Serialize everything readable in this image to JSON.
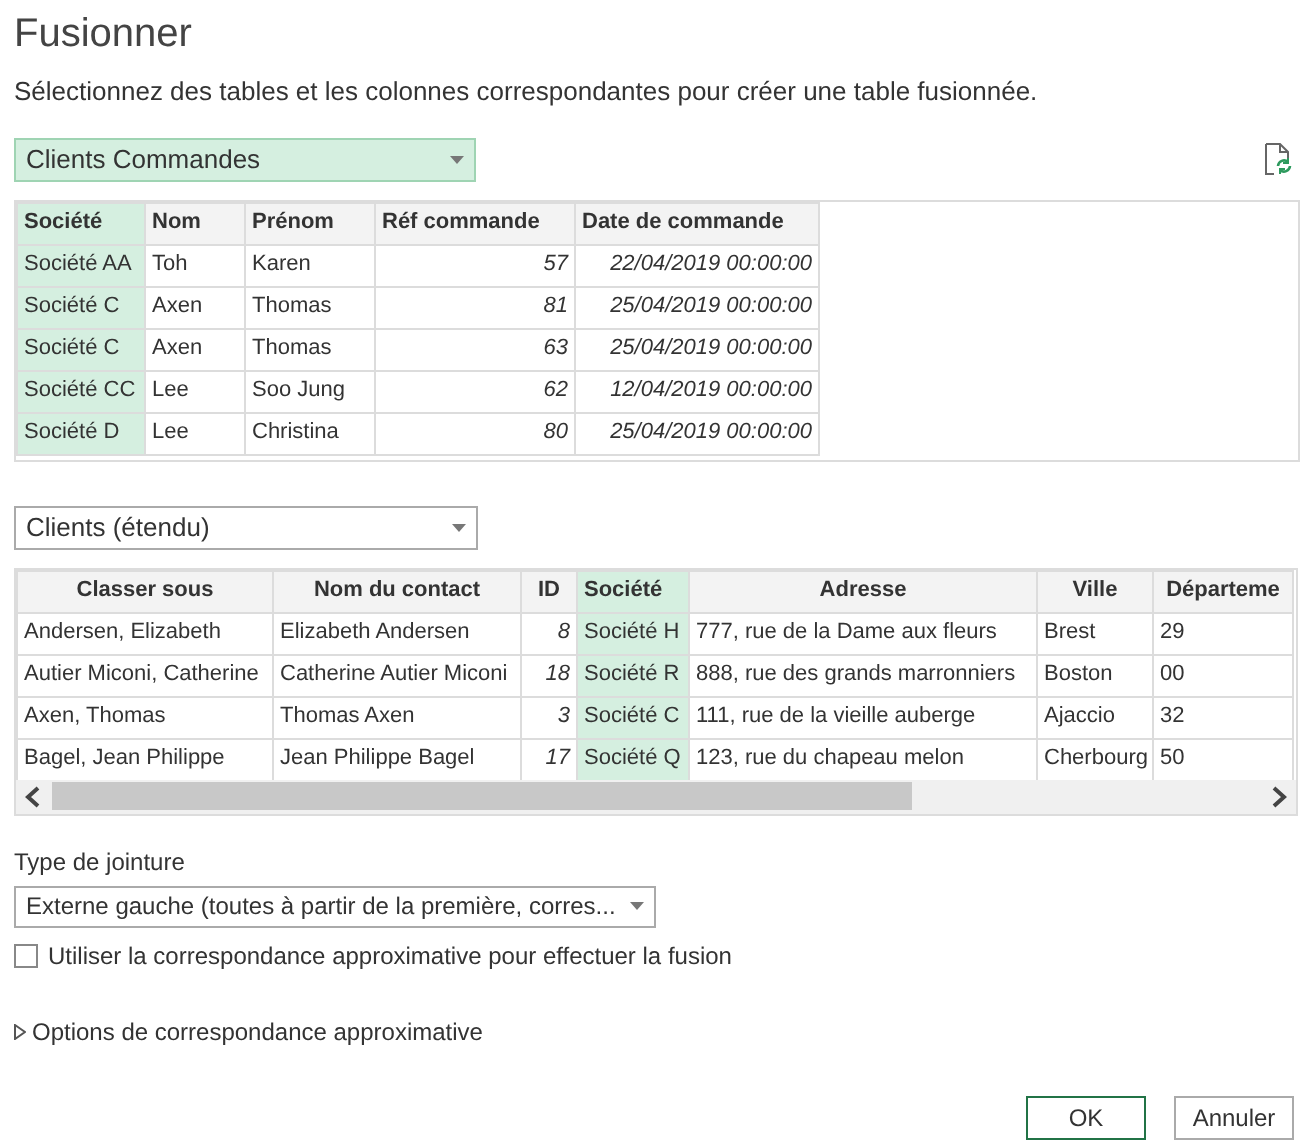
{
  "title": "Fusionner",
  "instruction": "Sélectionnez des tables et les colonnes correspondantes pour créer une table fusionnée.",
  "first_table": {
    "source": "Clients Commandes",
    "highlighted": true,
    "columns": [
      {
        "label": "Société",
        "selected": true,
        "kind": "text"
      },
      {
        "label": "Nom",
        "selected": false,
        "kind": "text"
      },
      {
        "label": "Prénom",
        "selected": false,
        "kind": "text"
      },
      {
        "label": "Réf commande",
        "selected": false,
        "kind": "number"
      },
      {
        "label": "Date de commande",
        "selected": false,
        "kind": "number"
      }
    ],
    "rows": [
      [
        "Société AA",
        "Toh",
        "Karen",
        "57",
        "22/04/2019 00:00:00"
      ],
      [
        "Société C",
        "Axen",
        "Thomas",
        "81",
        "25/04/2019 00:00:00"
      ],
      [
        "Société C",
        "Axen",
        "Thomas",
        "63",
        "25/04/2019 00:00:00"
      ],
      [
        "Société CC",
        "Lee",
        "Soo Jung",
        "62",
        "12/04/2019 00:00:00"
      ],
      [
        "Société D",
        "Lee",
        "Christina",
        "80",
        "25/04/2019 00:00:00"
      ]
    ]
  },
  "second_table": {
    "source": "Clients (étendu)",
    "highlighted": false,
    "columns": [
      {
        "label": "Classer sous",
        "selected": false,
        "kind": "text"
      },
      {
        "label": "Nom du contact",
        "selected": false,
        "kind": "text"
      },
      {
        "label": "ID",
        "selected": false,
        "kind": "number"
      },
      {
        "label": "Société",
        "selected": true,
        "kind": "text"
      },
      {
        "label": "Adresse",
        "selected": false,
        "kind": "text"
      },
      {
        "label": "Ville",
        "selected": false,
        "kind": "text"
      },
      {
        "label": "Départeme",
        "selected": false,
        "kind": "text"
      }
    ],
    "rows": [
      [
        "Andersen, Elizabeth",
        "Elizabeth Andersen",
        "8",
        "Société H",
        "777, rue de la Dame aux fleurs",
        "Brest",
        "29"
      ],
      [
        "Autier Miconi, Catherine",
        "Catherine Autier Miconi",
        "18",
        "Société R",
        "888, rue des grands marronniers",
        "Boston",
        "00"
      ],
      [
        "Axen, Thomas",
        "Thomas Axen",
        "3",
        "Société C",
        "111, rue de la vieille auberge",
        "Ajaccio",
        "32"
      ],
      [
        "Bagel, Jean Philippe",
        "Jean Philippe Bagel",
        "17",
        "Société Q",
        "123, rue du chapeau melon",
        "Cherbourg",
        "50"
      ]
    ]
  },
  "join": {
    "label": "Type de jointure",
    "value": "Externe gauche (toutes à partir de la première, corres..."
  },
  "fuzzy_checkbox": {
    "label": "Utiliser la correspondance approximative pour effectuer la fusion",
    "checked": false
  },
  "fuzzy_options": {
    "label": "Options de correspondance approximative",
    "expanded": false
  },
  "buttons": [
    {
      "label": "OK",
      "default": true
    },
    {
      "label": "Annuler",
      "default": false
    }
  ]
}
